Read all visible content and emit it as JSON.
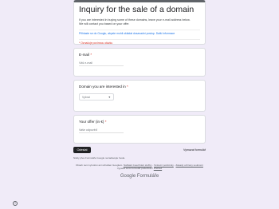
{
  "form": {
    "title": "Inquiry for the sale of a domain",
    "description_line1": "If you are interested in buying some of these domains, leave your e-mail address below.",
    "description_line2": "We will contact you based on your offer.",
    "account_text": "Přihlaste se do Googlu, abyste mohli ukládat dosavadní postup. Další informace",
    "required_note": "* Označuje povinnou otázku"
  },
  "questions": {
    "email": {
      "label": "E-mail",
      "star": "*",
      "placeholder": "Váš e-mail"
    },
    "domain": {
      "label": "Domain you are interested in",
      "star": "*",
      "selected": "Vybrat"
    },
    "offer": {
      "label": "Your offer (in €)",
      "star": "*",
      "placeholder": "Vaše odpověď"
    }
  },
  "actions": {
    "submit_label": "Odeslat",
    "clear_label": "Vymazat formulář"
  },
  "footer": {
    "never_submit": "Nikdy přes Formuláře Google nezadávejte hesla.",
    "legal_line1_prefix": "Obsah není vytvořen ani schválen Googlem.",
    "legal_link1": "Nahlásit zneužívání služby",
    "legal_sep": " - ",
    "legal_link2": "Smluvní podmínky",
    "legal_link3": "Zásady ochrany soukromí",
    "legal_line2_prefix": "Vypadá tento formulář podezřele?",
    "legal_link4": "Přehled",
    "logo_google": "Google",
    "logo_forms": "Formuláře"
  },
  "help_icon": "help-icon",
  "colors": {
    "background": "#f0ebf8",
    "accent": "#5f6368",
    "required": "#d93025"
  }
}
